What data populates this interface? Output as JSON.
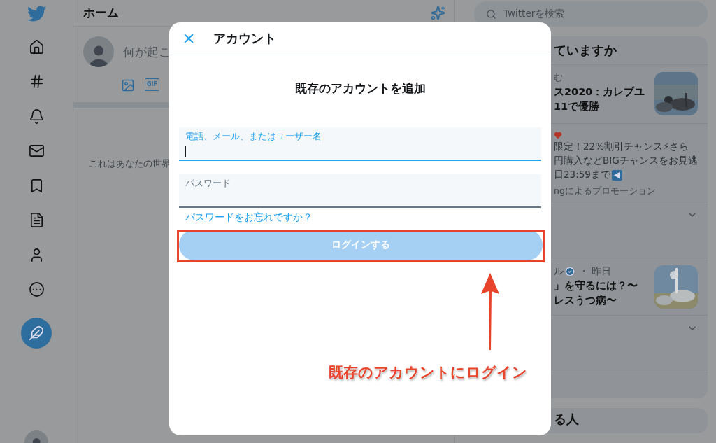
{
  "main": {
    "title": "ホーム",
    "composer": {
      "placeholder": "何が起こ",
      "gif_label": "GIF"
    },
    "empty_text": "これはあなたの世界"
  },
  "right": {
    "search": {
      "placeholder": "Twitterを検索"
    },
    "trends": {
      "title": "ていますか",
      "items": [
        {
          "kind": "trend",
          "context": "む",
          "lines": [
            "ス2020：カレブユ",
            "11で優勝"
          ]
        },
        {
          "kind": "promo",
          "lines": [
            "限定！22%割引チャンス⚡さら",
            "円購入などBIGチャンスをお見逃",
            "日23:59まで"
          ],
          "footer": "ngによるプロモーション"
        },
        {
          "kind": "blank"
        },
        {
          "kind": "news",
          "source": "ル",
          "time": "・ 昨日",
          "lines": [
            "」を守るには？〜",
            "レスうつ病〜"
          ]
        },
        {
          "kind": "blank"
        }
      ]
    },
    "follow": {
      "title": "る人"
    }
  },
  "dialog": {
    "title": "アカウント",
    "heading": "既存のアカウントを追加",
    "fields": [
      {
        "label": "電話、メール、またはユーザー名",
        "focused": true
      },
      {
        "label": "パスワード",
        "focused": false
      }
    ],
    "forgot_link": "パスワードをお忘れですか？",
    "login_button": {
      "label": "ログインする",
      "disabled": true
    }
  },
  "annotation": {
    "text": "既存のアカウントにログイン"
  }
}
